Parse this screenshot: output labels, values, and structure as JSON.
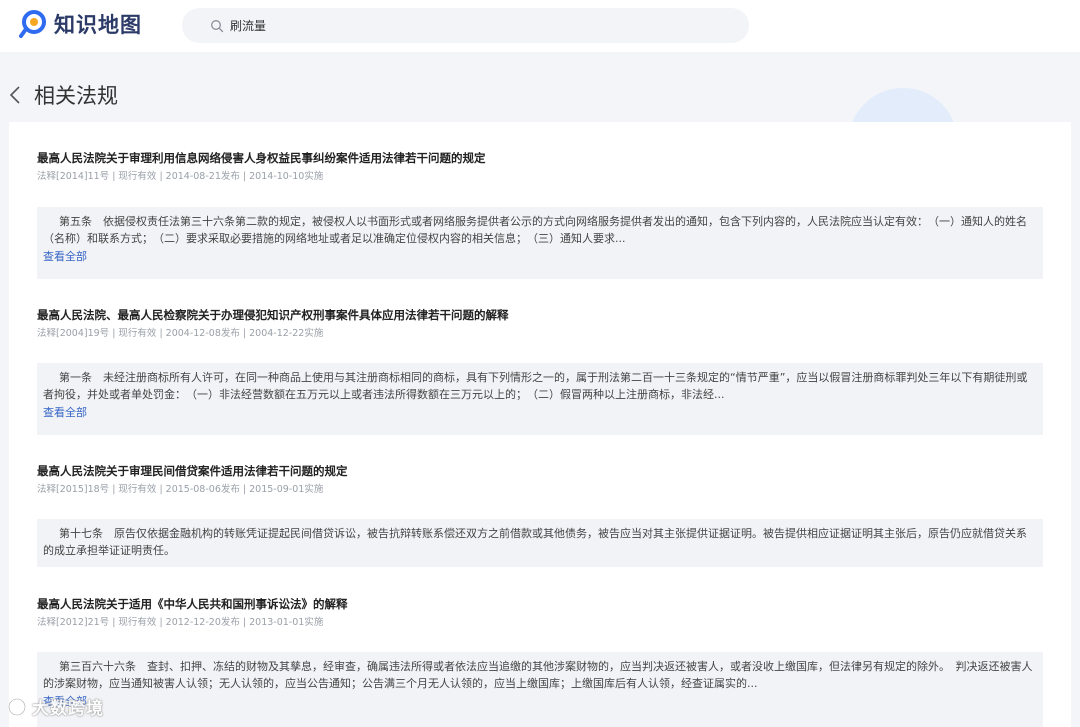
{
  "header": {
    "logo_text": "知识地图",
    "search_value": "刷流量"
  },
  "page": {
    "title": "相关法规"
  },
  "laws": [
    {
      "title": "最高人民法院关于审理利用信息网络侵害人身权益民事纠纷案件适用法律若干问题的规定",
      "meta": "法释[2014]11号 | 现行有效 | 2014-08-21发布 | 2014-10-10实施",
      "excerpt": "第五条　依据侵权责任法第三十六条第二款的规定，被侵权人以书面形式或者网络服务提供者公示的方式向网络服务提供者发出的通知，包含下列内容的，人民法院应当认定有效：　（一）通知人的姓名（名称）和联系方式；　（二）要求采取必要措施的网络地址或者足以准确定位侵权内容的相关信息；　（三）通知人要求...",
      "view_all": "查看全部"
    },
    {
      "title": "最高人民法院、最高人民检察院关于办理侵犯知识产权刑事案件具体应用法律若干问题的解释",
      "meta": "法释[2004]19号 | 现行有效 | 2004-12-08发布 | 2004-12-22实施",
      "excerpt": "第一条　未经注册商标所有人许可，在同一种商品上使用与其注册商标相同的商标，具有下列情形之一的，属于刑法第二百一十三条规定的“情节严重”，应当以假冒注册商标罪判处三年以下有期徒刑或者拘役，并处或者单处罚金：　（一）非法经营数额在五万元以上或者违法所得数额在三万元以上的；　（二）假冒两种以上注册商标，非法经...",
      "view_all": "查看全部"
    },
    {
      "title": "最高人民法院关于审理民间借贷案件适用法律若干问题的规定",
      "meta": "法释[2015]18号 | 现行有效 | 2015-08-06发布 | 2015-09-01实施",
      "excerpt": "第十七条　原告仅依据金融机构的转账凭证提起民间借贷诉讼，被告抗辩转账系偿还双方之前借款或其他债务，被告应当对其主张提供证据证明。被告提供相应证据证明其主张后，原告仍应就借贷关系的成立承担举证证明责任。"
    },
    {
      "title": "最高人民法院关于适用《中华人民共和国刑事诉讼法》的解释",
      "meta": "法释[2012]21号 | 现行有效 | 2012-12-20发布 | 2013-01-01实施",
      "excerpt": "第三百六十六条　查封、扣押、冻结的财物及其孳息，经审查，确属违法所得或者依法应当追缴的其他涉案财物的，应当判决返还被害人，或者没收上缴国库，但法律另有规定的除外。　判决返还被害人的涉案财物，应当通知被害人认领；无人认领的，应当公告通知；公告满三个月无人认领的，应当上缴国库；上缴国库后有人认领，经查证属实的...",
      "view_all": "查看全部"
    }
  ],
  "watermark": {
    "text": "大数跨境"
  },
  "colors": {
    "accent": "#3565c6",
    "logo_text": "#2b3a67",
    "excerpt_bg": "#f2f3f6"
  }
}
